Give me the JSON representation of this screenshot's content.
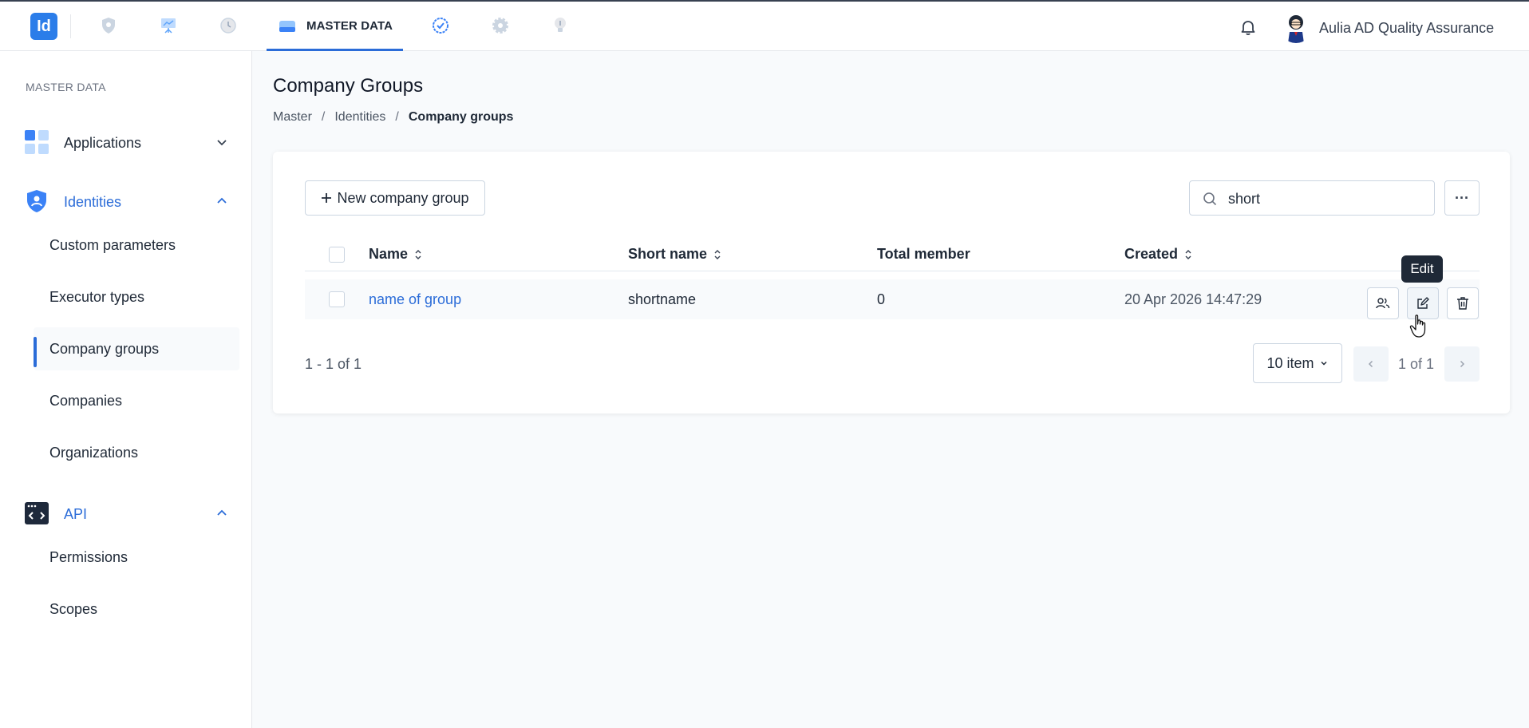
{
  "topbar": {
    "logo": "Id",
    "active_tab": "MASTER DATA",
    "username": "Aulia AD Quality Assurance",
    "icons": [
      "shield-icon",
      "presentation-icon",
      "clock-icon",
      "database-icon",
      "check-badge-icon",
      "gear-icon",
      "lightbulb-icon",
      "bell-icon"
    ],
    "accent": "#2b6cd8"
  },
  "sidebar": {
    "section": "MASTER DATA",
    "groups": [
      {
        "label": "Applications",
        "expanded": false
      },
      {
        "label": "Identities",
        "expanded": true,
        "items": [
          "Custom parameters",
          "Executor types",
          "Company groups",
          "Companies",
          "Organizations"
        ]
      },
      {
        "label": "API",
        "expanded": true,
        "items": [
          "Permissions",
          "Scopes"
        ]
      }
    ],
    "active_item": "Company groups"
  },
  "page": {
    "title": "Company Groups",
    "breadcrumb": [
      "Master",
      "Identities",
      "Company groups"
    ]
  },
  "toolbar": {
    "new_label": "New company group",
    "search_value": "short",
    "more_label": "···"
  },
  "table": {
    "columns": [
      "Name",
      "Short name",
      "Total member",
      "Created"
    ],
    "rows": [
      {
        "name": "name of group",
        "short_name": "shortname",
        "total_member": "0",
        "created": "20 Apr 2026 14:47:29"
      }
    ],
    "tooltip": "Edit"
  },
  "pagination": {
    "range": "1 - 1 of 1",
    "page_size": "10 item",
    "page_info": "1 of 1"
  }
}
